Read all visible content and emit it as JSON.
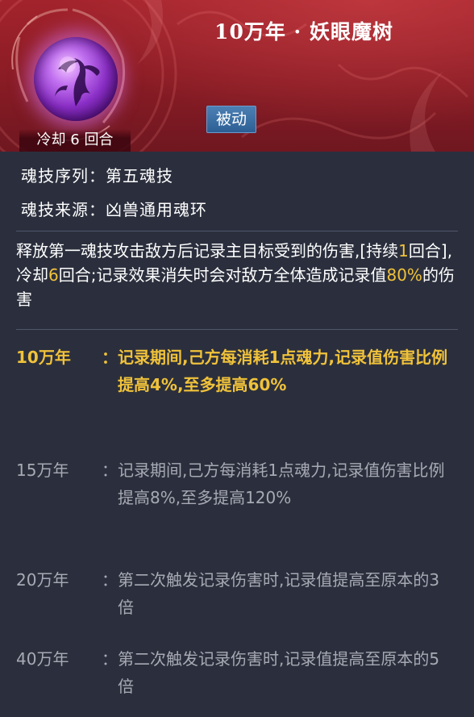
{
  "skill": {
    "title": "10万年 · 妖眼魔树",
    "cooldown": "冷却 6 回合",
    "tag": "被动",
    "icon": "purple-demon-tree-orb-icon"
  },
  "meta": {
    "sequence": "魂技序列：第五魂技",
    "source": "魂技来源：凶兽通用魂环"
  },
  "description": {
    "part1": "释放第一魂技攻击敌方后记录主目标受到的伤害,[持续",
    "num1": "1",
    "part2": "回合],冷却",
    "num2": "6",
    "part3": "回合;记录效果消失时会对敌方全体造成记录值",
    "num3": "80%",
    "part4": "的伤害"
  },
  "tiers": [
    {
      "label": "10万年",
      "colon": "：",
      "text": "记录期间,己方每消耗1点魂力,记录值伤害比例提高4%,至多提高60%",
      "active": true
    },
    {
      "label": "15万年",
      "colon": "：",
      "text": "记录期间,己方每消耗1点魂力,记录值伤害比例提高8%,至多提高120%",
      "active": false
    },
    {
      "label": "20万年",
      "colon": "：",
      "text": "第二次触发记录伤害时,记录值提高至原本的3倍",
      "active": false
    },
    {
      "label": "40万年",
      "colon": "：",
      "text": "第二次触发记录伤害时,记录值提高至原本的5倍",
      "active": false
    }
  ],
  "colors": {
    "header": "#8b1c25",
    "highlight": "#f0c23a",
    "tag": "#2d5f95",
    "background": "#2b2f3d"
  }
}
